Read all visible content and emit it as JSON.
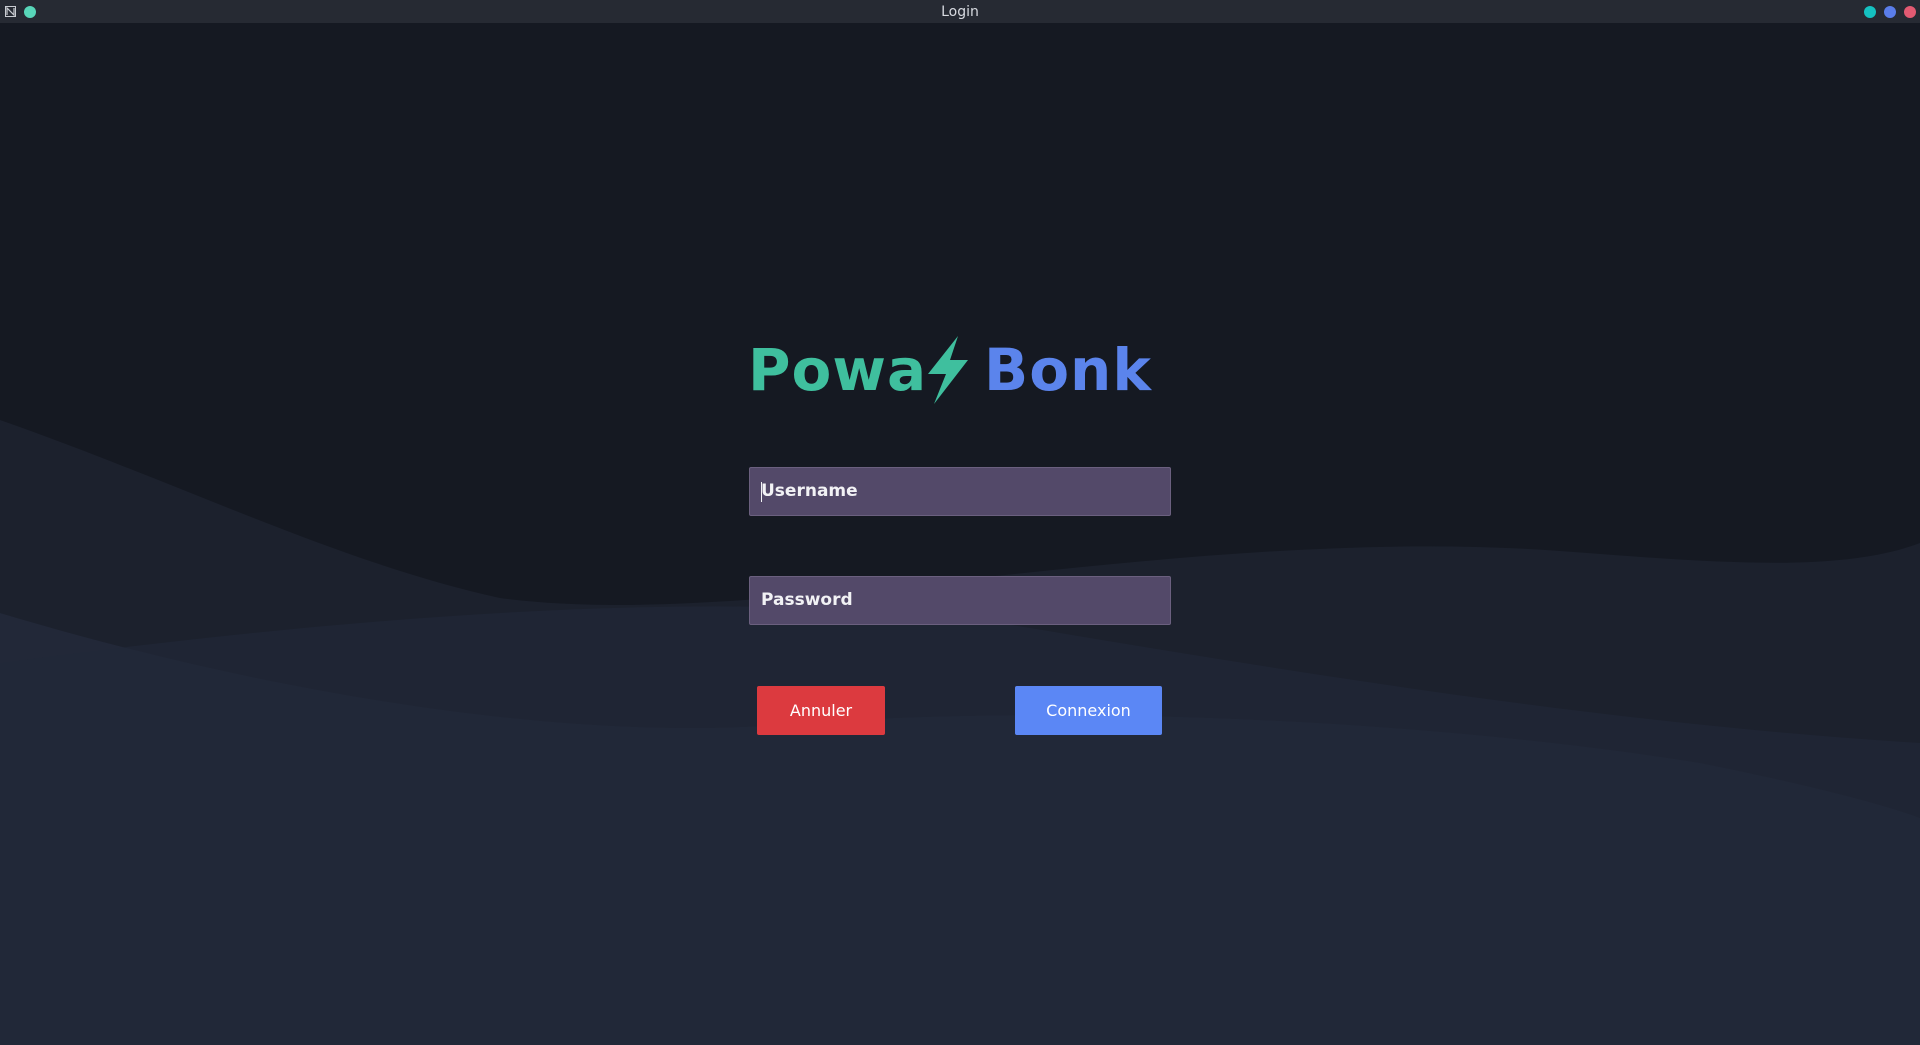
{
  "window": {
    "title": "Login",
    "buttons": [
      "minimize",
      "maximize",
      "close"
    ]
  },
  "logo": {
    "part1": "Powa",
    "part2": "Bonk",
    "icon": "lightning-bolt-icon",
    "colors": {
      "part1": "#3fbf9e",
      "part2": "#5b84ec"
    }
  },
  "form": {
    "username": {
      "placeholder": "Username",
      "value": ""
    },
    "password": {
      "placeholder": "Password",
      "value": ""
    },
    "cancel_label": "Annuler",
    "login_label": "Connexion"
  },
  "colors": {
    "background": "#151922",
    "field": "#534969",
    "cancel": "#dc3a3f",
    "login": "#5b87f5"
  }
}
